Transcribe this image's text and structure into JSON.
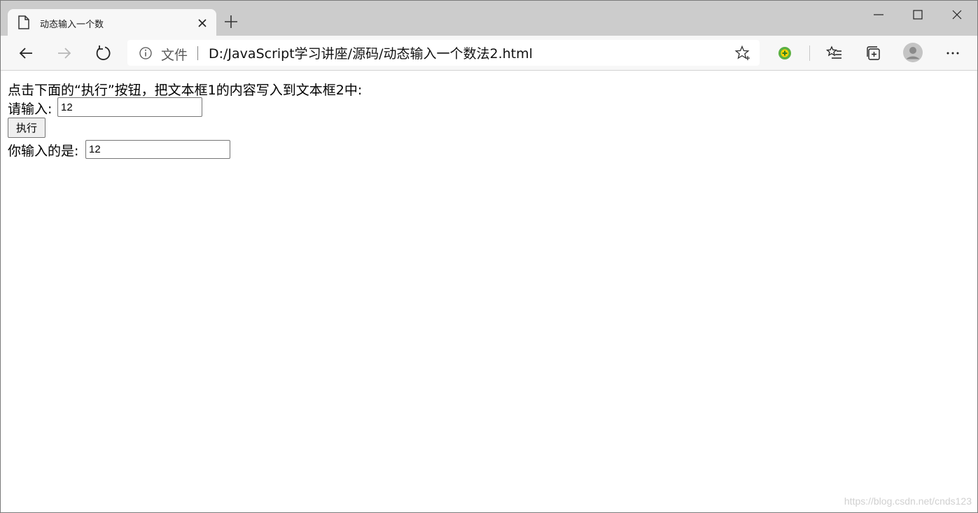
{
  "browser": {
    "tab": {
      "title": "动态输入一个数"
    },
    "address_bar": {
      "security_label": "文件",
      "url": "D:/JavaScript学习讲座/源码/动态输入一个数法2.html"
    }
  },
  "page": {
    "instruction": "点击下面的“执行”按钮，把文本框1的内容写入到文本框2中:",
    "input_label": "请输入:",
    "input_value": "12",
    "execute_button": "执行",
    "output_label": "你输入的是:",
    "output_value": "12"
  },
  "watermark": "https://blog.csdn.net/cnds123",
  "icons": {
    "tab": "page-icon",
    "tab_close": "close-icon",
    "new_tab": "plus-icon",
    "back": "arrow-left-icon",
    "forward": "arrow-right-icon",
    "refresh": "refresh-icon",
    "info": "info-icon",
    "favorite": "star-icon",
    "extension": "extension-icon",
    "favorites": "favorites-list-icon",
    "collections": "collections-icon",
    "profile": "avatar-icon",
    "menu": "more-icon"
  },
  "colors": {
    "tab_strip": "#cccccc",
    "toolbar": "#f7f7f7",
    "page": "#ffffff"
  }
}
